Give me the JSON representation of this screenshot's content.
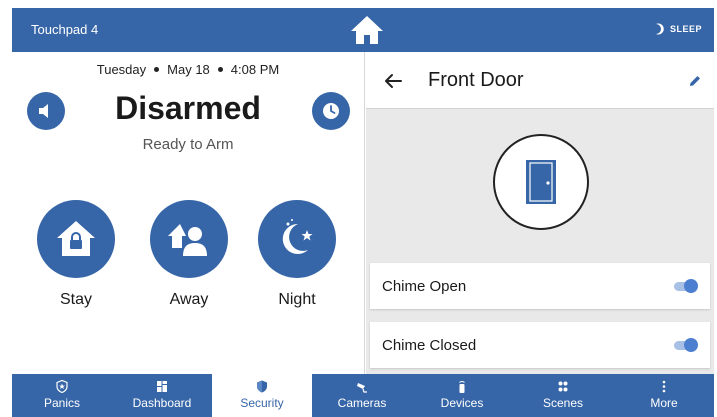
{
  "topbar": {
    "device_name": "Touchpad 4",
    "sleep_label": "SLEEP"
  },
  "left": {
    "day": "Tuesday",
    "date": "May 18",
    "time": "4:08 PM",
    "status": "Disarmed",
    "substatus": "Ready to Arm",
    "arm_modes": [
      {
        "label": "Stay"
      },
      {
        "label": "Away"
      },
      {
        "label": "Night"
      }
    ]
  },
  "right": {
    "title": "Front Door",
    "toggles": [
      {
        "label": "Chime Open",
        "on": true
      },
      {
        "label": "Chime Closed",
        "on": true
      }
    ]
  },
  "nav": {
    "items": [
      {
        "label": "Panics",
        "icon": "star-shield-icon"
      },
      {
        "label": "Dashboard",
        "icon": "dashboard-icon"
      },
      {
        "label": "Security",
        "icon": "shield-icon",
        "active": true
      },
      {
        "label": "Cameras",
        "icon": "camera-icon"
      },
      {
        "label": "Devices",
        "icon": "remote-icon"
      },
      {
        "label": "Scenes",
        "icon": "scenes-icon"
      },
      {
        "label": "More",
        "icon": "more-icon"
      }
    ]
  },
  "colors": {
    "primary": "#3766a8",
    "toggle_on": "#4d7fd1",
    "panel_bg": "#e9e9e9"
  }
}
